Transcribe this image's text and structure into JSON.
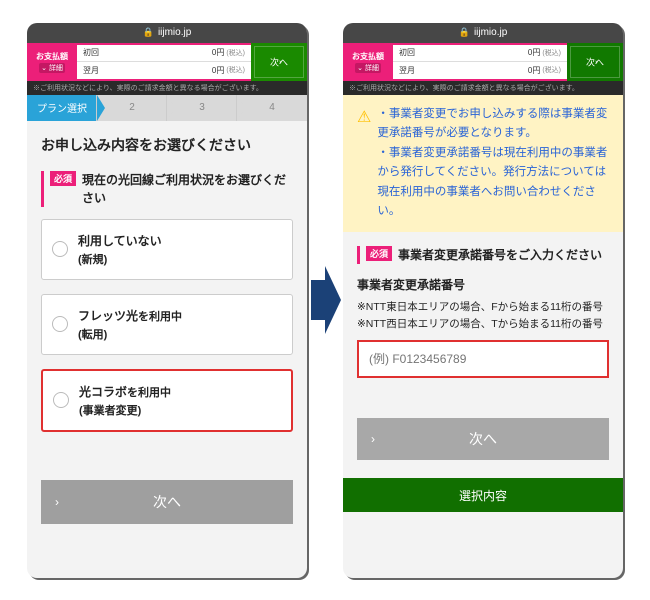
{
  "url": {
    "domain": "iijmio.jp",
    "lock": "🔒"
  },
  "pay": {
    "badgeL1": "お支払額",
    "badgeL2": "詳細",
    "row1_label": "初回",
    "row1_value": "0円",
    "row1_tax": "(税込)",
    "row2_label": "翌月",
    "row2_value": "0円",
    "row2_tax": "(税込)"
  },
  "next_small": "次へ",
  "disclaimer": "※ご利用状況などにより、実際のご請求金額と異なる場合がございます。",
  "steps": {
    "s1": "プラン選択",
    "s2": "2",
    "s3": "3",
    "s4": "4"
  },
  "left": {
    "h1": "お申し込み内容をお選びください",
    "req": "必須",
    "field": "現在の光回線ご利用状況をお選びください",
    "opts": [
      {
        "t1": "利用していない",
        "t2": "(新規)"
      },
      {
        "t1a": "フレッツ光",
        "t1b": "を利用中",
        "t2": "(転用)"
      },
      {
        "t1a": "光コラボ",
        "t1b": "を利用中",
        "t2": "(事業者変更)"
      }
    ],
    "bigbtn": "次へ"
  },
  "right": {
    "notice": [
      "事業者変更でお申し込みする際は事業者変更承諾番号が必要となります。",
      "事業者変更承諾番号は現在利用中の事業者から発行してください。発行方法については現在利用中の事業者へお問い合わせください。"
    ],
    "req": "必須",
    "field": "事業者変更承諾番号をご入力ください",
    "sub": "事業者変更承諾番号",
    "help1": "※NTT東日本エリアの場合、Fから始まる11桁の番号",
    "help2": "※NTT西日本エリアの場合、Tから始まる11桁の番号",
    "placeholder": "(例) F0123456789",
    "bigbtn": "次へ",
    "bar2": "選択内容"
  }
}
